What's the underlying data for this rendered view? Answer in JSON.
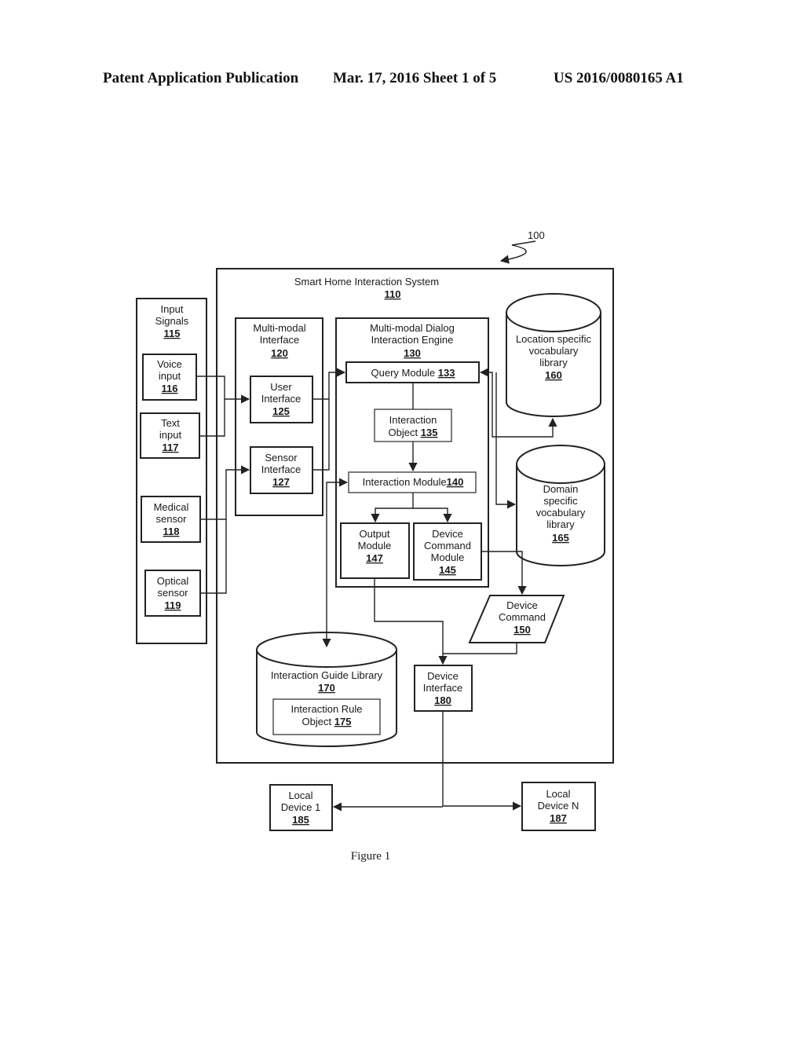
{
  "header": {
    "publication": "Patent Application Publication",
    "date_sheet": "Mar. 17, 2016  Sheet 1 of 5",
    "number": "US 2016/0080165 A1"
  },
  "figure": {
    "ref_label": "100",
    "caption": "Figure 1",
    "system": {
      "title": "Smart Home Interaction System",
      "ref": "110"
    },
    "input_signals": {
      "title_lines": [
        "Input",
        "Signals"
      ],
      "ref": "115",
      "items": [
        {
          "lines": [
            "Voice",
            "input"
          ],
          "ref": "116"
        },
        {
          "lines": [
            "Text",
            "input"
          ],
          "ref": "117"
        },
        {
          "lines": [
            "Medical",
            "sensor"
          ],
          "ref": "118"
        },
        {
          "lines": [
            "Optical",
            "sensor"
          ],
          "ref": "119"
        }
      ]
    },
    "multimodal_interface": {
      "title_lines": [
        "Multi-modal",
        "Interface"
      ],
      "ref": "120",
      "user_interface": {
        "lines": [
          "User",
          "Interface"
        ],
        "ref": "125"
      },
      "sensor_interface": {
        "lines": [
          "Sensor",
          "Interface"
        ],
        "ref": "127"
      }
    },
    "engine": {
      "title_lines": [
        "Multi-modal Dialog",
        "Interaction Engine"
      ],
      "ref": "130",
      "query_module": {
        "label": "Query Module ",
        "ref": "133"
      },
      "interaction_object": {
        "lines": [
          "Interaction",
          "Object "
        ],
        "ref": "135"
      },
      "interaction_module": {
        "label": "Interaction Module",
        "ref": "140"
      },
      "output_module": {
        "lines": [
          "Output",
          "Module"
        ],
        "ref": "147"
      },
      "device_command_module": {
        "lines": [
          "Device",
          "Command",
          "Module"
        ],
        "ref": "145"
      }
    },
    "location_library": {
      "lines": [
        "Location specific",
        "vocabulary",
        "library"
      ],
      "ref": "160"
    },
    "domain_library": {
      "lines": [
        "Domain",
        "specific",
        "vocabulary",
        "library"
      ],
      "ref": "165"
    },
    "device_command": {
      "lines": [
        "Device",
        "Command"
      ],
      "ref": "150"
    },
    "guide_library": {
      "label": "Interaction Guide Library",
      "ref": "170"
    },
    "rule_object": {
      "lines": [
        "Interaction Rule",
        "Object "
      ],
      "ref": "175"
    },
    "device_interface": {
      "lines": [
        "Device",
        "Interface"
      ],
      "ref": "180"
    },
    "local_device_1": {
      "lines": [
        "Local",
        "Device 1"
      ],
      "ref": "185"
    },
    "local_device_n": {
      "lines": [
        "Local",
        "Device N"
      ],
      "ref": "187"
    }
  }
}
